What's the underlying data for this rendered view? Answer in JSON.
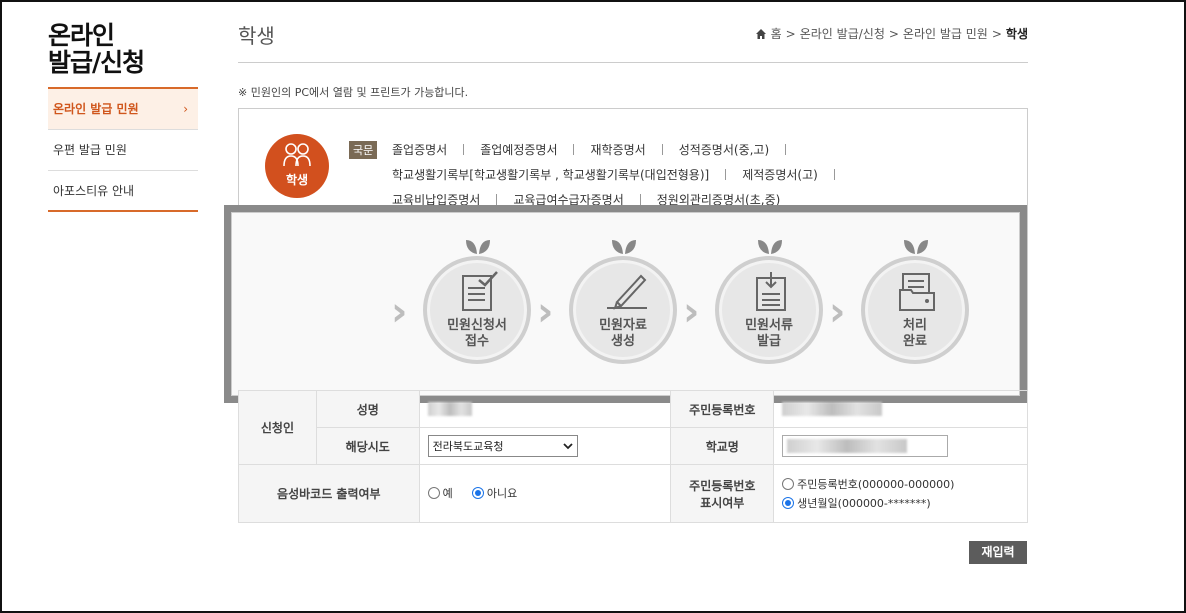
{
  "sidebar": {
    "title_line1": "온라인",
    "title_line2": "발급/신청",
    "items": [
      {
        "label": "온라인 발급 민원",
        "active": true,
        "chevron": "›"
      },
      {
        "label": "우편 발급 민원"
      },
      {
        "label": "아포스티유 안내"
      }
    ]
  },
  "header": {
    "title": "학생",
    "breadcrumb": [
      "홈",
      ">",
      "온라인 발급/신청",
      ">",
      "온라인 발급 민원",
      ">",
      "학생"
    ]
  },
  "notice": "※ 민원인의 PC에서 열람 및 프린트가 가능합니다.",
  "category": {
    "badge": "학생",
    "lang_tag": "국문",
    "docs_row1": [
      "졸업증명서",
      "졸업예정증명서",
      "재학증명서",
      "성적증명서(중,고)"
    ],
    "docs_row2": [
      "학교생활기록부[학교생활기록부 , 학교생활기록부(대입전형용)]",
      "제적증명서(고)"
    ],
    "docs_row3": [
      "교육비납입증명서",
      "교육급여수급자증명서",
      "정원외관리증명서(초,중)"
    ]
  },
  "process": {
    "steps": [
      {
        "line1": "민원신청서",
        "line2": "접수",
        "icon": "clipboard-check-icon"
      },
      {
        "line1": "민원자료",
        "line2": "생성",
        "icon": "pencil-icon"
      },
      {
        "line1": "민원서류",
        "line2": "발급",
        "icon": "document-download-icon"
      },
      {
        "line1": "처리",
        "line2": "완료",
        "icon": "folder-icon"
      }
    ],
    "arrow": "›"
  },
  "form": {
    "applicant_label": "신청인",
    "name_label": "성명",
    "rrn_label": "주민등록번호",
    "region_label": "해당시도",
    "region_value": "전라북도교육청",
    "school_label": "학교명",
    "barcode_label": "음성바코드 출력여부",
    "barcode_yes": "예",
    "barcode_no": "아니요",
    "rrn_display_label_1": "주민등록번호",
    "rrn_display_label_2": "표시여부",
    "rrn_opt1": "주민등록번호(000000-000000)",
    "rrn_opt2": "생년월일(000000-*******)"
  },
  "buttons": {
    "reset": "재입력"
  },
  "colors": {
    "accent": "#d2501e",
    "radio_selected": "#1a73e8"
  }
}
